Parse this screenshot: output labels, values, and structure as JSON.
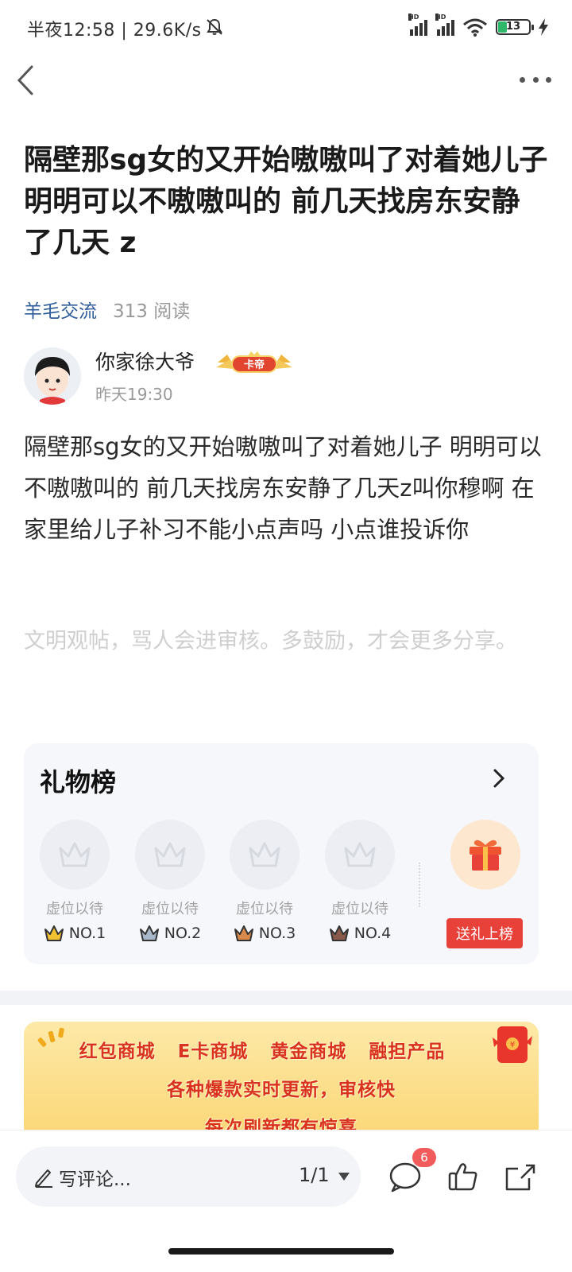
{
  "status_bar": {
    "time_speed": "半夜12:58 | 29.6K/s",
    "battery_level": "13",
    "signal_label": "HD"
  },
  "post": {
    "title": "隔壁那sg女的又开始嗷嗷叫了对着她儿子 明明可以不嗷嗷叫的 前几天找房东安静了几天 z",
    "forum": "羊毛交流",
    "read_count": "313 阅读",
    "author": "你家徐大爷",
    "author_badge": "卡帝",
    "time": "昨天19:30",
    "body": "隔壁那sg女的又开始嗷嗷叫了对着她儿子 明明可以不嗷嗷叫的 前几天找房东安静了几天z叫你穆啊 在家里给儿子补习不能小点声吗 小点谁投诉你",
    "civility_note": "文明观帖，骂人会进审核。多鼓励，才会更多分享。"
  },
  "gift_board": {
    "title": "礼物榜",
    "slots": [
      {
        "label": "虚位以待",
        "rank": "NO.1",
        "crown_color": "#f2c230"
      },
      {
        "label": "虚位以待",
        "rank": "NO.2",
        "crown_color": "#a9b8c8"
      },
      {
        "label": "虚位以待",
        "rank": "NO.3",
        "crown_color": "#d98a4a"
      },
      {
        "label": "虚位以待",
        "rank": "NO.4",
        "crown_color": "#8a5a4a"
      }
    ],
    "send_button": "送礼上榜"
  },
  "banner": {
    "row1": [
      "红包商城",
      "E卡商城",
      "黄金商城",
      "融担产品"
    ],
    "row2": "各种爆款实时更新，审核快",
    "row3": "每次刷新都有惊喜"
  },
  "bottom_bar": {
    "comment_placeholder": "写评论...",
    "page_indicator": "1/1",
    "comment_count": "6"
  },
  "colors": {
    "accent_link": "#2e5c9a",
    "send_button": "#e8413a",
    "badge": "#f25b5b"
  }
}
